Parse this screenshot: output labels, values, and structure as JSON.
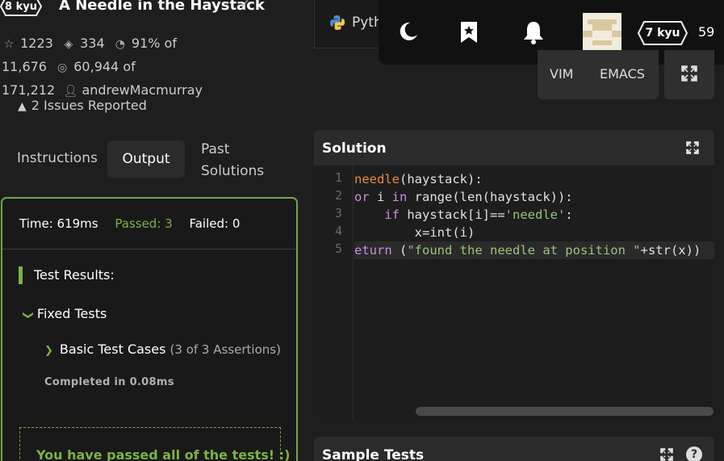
{
  "kata": {
    "kyu": "8 kyu",
    "title": "A Needle in the Haystack",
    "check_icon": "check-icon",
    "stats": {
      "stars": "1223",
      "collections": "334",
      "satisfaction": "91% of",
      "satisfaction_votes": "11,676",
      "completions": "60,944 of",
      "completions_total": "171,212",
      "author": "andrewMacmurray"
    },
    "issues": "2 Issues Reported"
  },
  "tabs": {
    "instructions": "Instructions",
    "output": "Output",
    "past_solutions": "Past Solutions",
    "active": "output"
  },
  "output": {
    "time": "Time: 619ms",
    "passed": "Passed: 3",
    "failed": "Failed: 0",
    "results_header": "Test Results:",
    "fixed_tests": "Fixed Tests",
    "basic_tests": "Basic Test Cases",
    "assertions": "(3 of 3 Assertions)",
    "completed": "Completed in 0.08ms",
    "passed_message": "You have passed all of the tests! :)"
  },
  "editor": {
    "language": "Pyth",
    "modes": [
      "VIM",
      "EMACS"
    ],
    "solution_title": "Solution",
    "sample_tests_title": "Sample Tests",
    "line_numbers": [
      "1",
      "2",
      "3",
      "4",
      "5"
    ]
  },
  "user": {
    "rank": "7 kyu",
    "honor": "59"
  },
  "colors": {
    "pass_green": "#7cb342",
    "keyword_orange": "#e88a3a",
    "keyword_purple": "#c98be8",
    "string_green": "#98c379"
  }
}
